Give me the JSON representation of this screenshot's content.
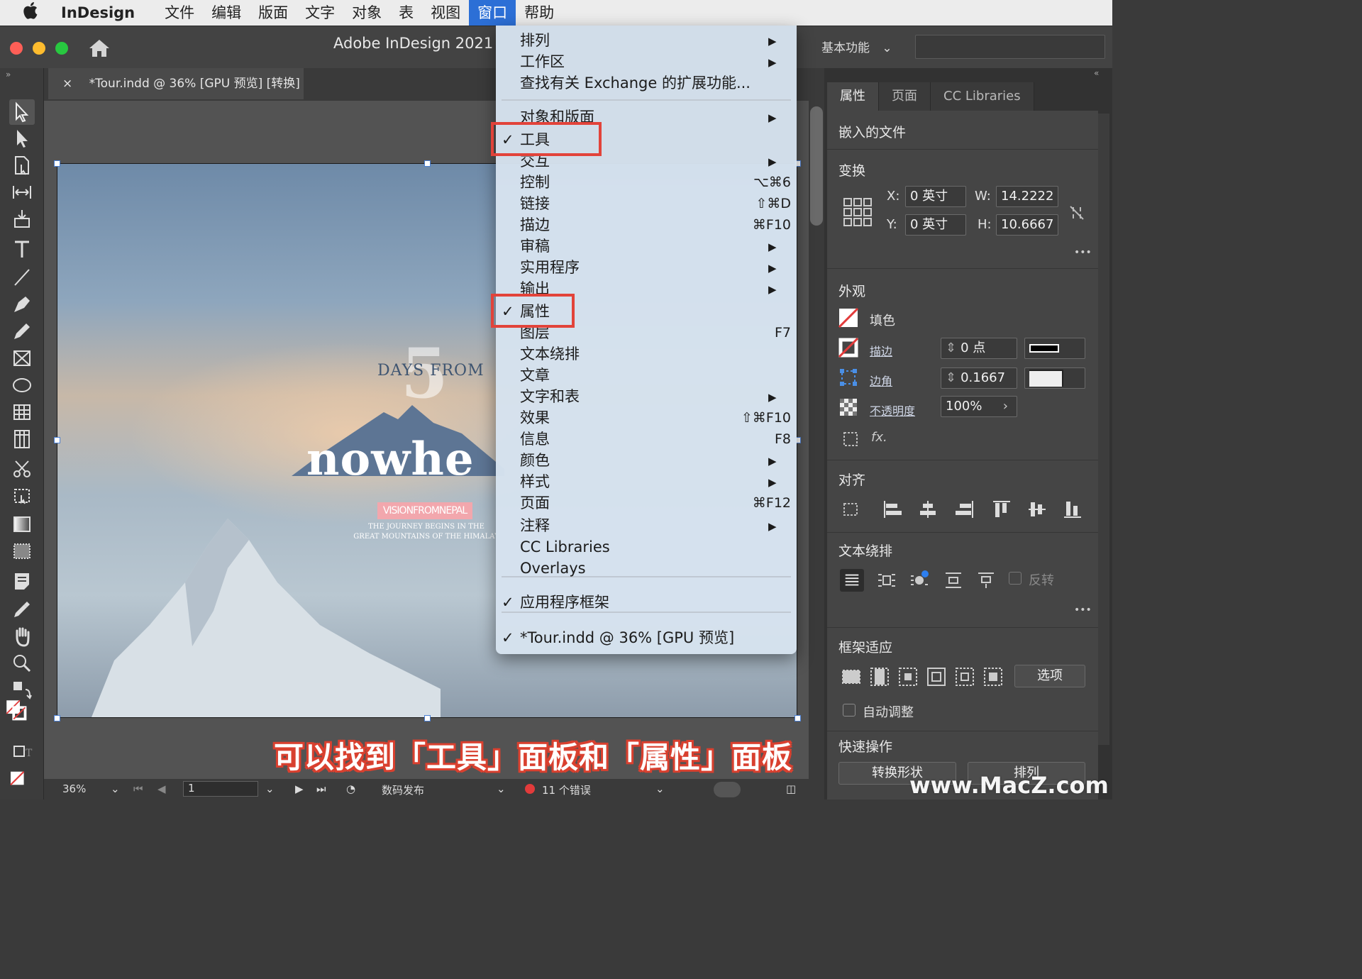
{
  "menubar": {
    "apple": "",
    "app": "InDesign",
    "items": [
      "文件",
      "编辑",
      "版面",
      "文字",
      "对象",
      "表",
      "视图",
      "窗口",
      "帮助"
    ]
  },
  "appbar": {
    "title": "Adobe InDesign 2021",
    "workspace": "基本功能"
  },
  "document_tab": {
    "close": "×",
    "title": "*Tour.indd @ 36% [GPU 预览] [转换]"
  },
  "artwork": {
    "days_from": "DAYS FROM",
    "five": "5",
    "nowhere": "nowhe",
    "vision": "VISIONFROMNEPAL",
    "journey_line1": "THE JOURNEY BEGINS IN THE",
    "journey_line2": "GREAT MOUNTAINS OF THE HIMALAY"
  },
  "window_menu": {
    "items": [
      {
        "label": "排列",
        "submenu": true
      },
      {
        "label": "工作区",
        "submenu": true
      },
      {
        "label": "查找有关 Exchange 的扩展功能..."
      },
      {
        "label": "对象和版面",
        "submenu": true
      },
      {
        "label": "工具",
        "checked": true
      },
      {
        "label": "交互",
        "submenu": true
      },
      {
        "label": "控制",
        "shortcut": "⌥⌘6"
      },
      {
        "label": "链接",
        "shortcut": "⇧⌘D"
      },
      {
        "label": "描边",
        "shortcut": "⌘F10"
      },
      {
        "label": "审稿",
        "submenu": true
      },
      {
        "label": "实用程序",
        "submenu": true
      },
      {
        "label": "输出",
        "submenu": true
      },
      {
        "label": "属性",
        "checked": true
      },
      {
        "label": "图层",
        "shortcut": "F7"
      },
      {
        "label": "文本绕排"
      },
      {
        "label": "文章"
      },
      {
        "label": "文字和表",
        "submenu": true
      },
      {
        "label": "效果",
        "shortcut": "⇧⌘F10"
      },
      {
        "label": "信息",
        "shortcut": "F8"
      },
      {
        "label": "颜色",
        "submenu": true
      },
      {
        "label": "样式",
        "submenu": true
      },
      {
        "label": "页面",
        "shortcut": "⌘F12"
      },
      {
        "label": "注释",
        "submenu": true
      },
      {
        "label": "CC Libraries"
      },
      {
        "label": "Overlays"
      },
      {
        "label": "应用程序框架",
        "checked": true
      },
      {
        "label": "*Tour.indd @ 36% [GPU 预览]",
        "checked": true
      }
    ],
    "checkmark": "✓",
    "arrow": "▶"
  },
  "caption": "可以找到「工具」面板和「属性」面板",
  "properties_panel": {
    "tabs": [
      "属性",
      "页面",
      "CC Libraries"
    ],
    "embedded_file": "嵌入的文件",
    "transform": {
      "title": "变换",
      "x_label": "X:",
      "x_value": "0 英寸",
      "y_label": "Y:",
      "y_value": "0 英寸",
      "w_label": "W:",
      "w_value": "14.2222",
      "h_label": "H:",
      "h_value": "10.6667"
    },
    "appearance": {
      "title": "外观",
      "fill": "填色",
      "stroke": "描边",
      "stroke_value": "0 点",
      "corner": "边角",
      "corner_value": "0.1667",
      "opacity": "不透明度",
      "opacity_value": "100%",
      "fx": "fx."
    },
    "align": {
      "title": "对齐"
    },
    "text_wrap": {
      "title": "文本绕排",
      "invert": "反转"
    },
    "frame_fitting": {
      "title": "框架适应",
      "options_button": "选项",
      "auto_fit": "自动调整"
    },
    "quick_actions": {
      "title": "快速操作",
      "convert_shape": "转换形状",
      "arrange": "排列"
    },
    "more": "•••"
  },
  "statusbar": {
    "zoom": "36%",
    "page": "1",
    "preflight_profile": "数码发布",
    "errors": "11 个错误"
  },
  "watermark": "www.MacZ.com",
  "colors": {
    "menu_highlight": "#2c6fd6",
    "red_box": "#e2433a",
    "error_dot": "#e23b3b",
    "caption_outline": "#d9402f"
  }
}
